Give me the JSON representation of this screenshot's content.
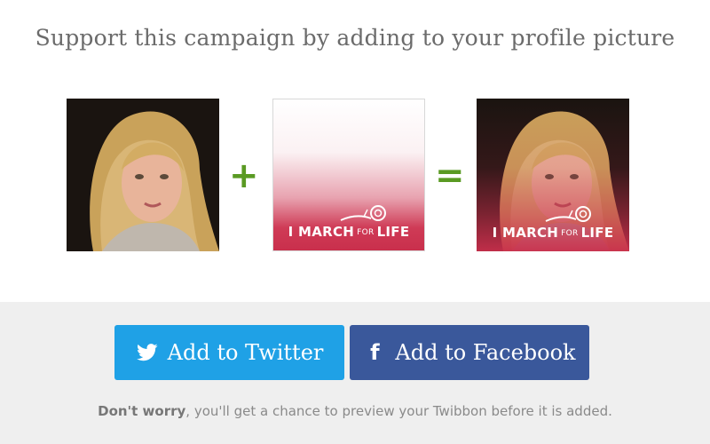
{
  "heading": "Support this campaign by adding to your profile picture",
  "overlay": {
    "logo_left": "I MARCH",
    "logo_small": "FOR",
    "logo_right": "LIFE"
  },
  "operators": {
    "plus": "+",
    "equals": "="
  },
  "buttons": {
    "twitter": {
      "label": "Add to Twitter",
      "icon": "twitter-bird-icon"
    },
    "facebook": {
      "label": "Add to Facebook",
      "icon": "facebook-f-icon",
      "glyph": "f"
    }
  },
  "note": {
    "bold": "Don't worry",
    "rest": ", you'll get a chance to preview your Twibbon before it is added."
  },
  "colors": {
    "twitter": "#1fa1e6",
    "facebook": "#3a589b",
    "operator": "#5a9a23",
    "overlay_red": "#c92f4c"
  }
}
